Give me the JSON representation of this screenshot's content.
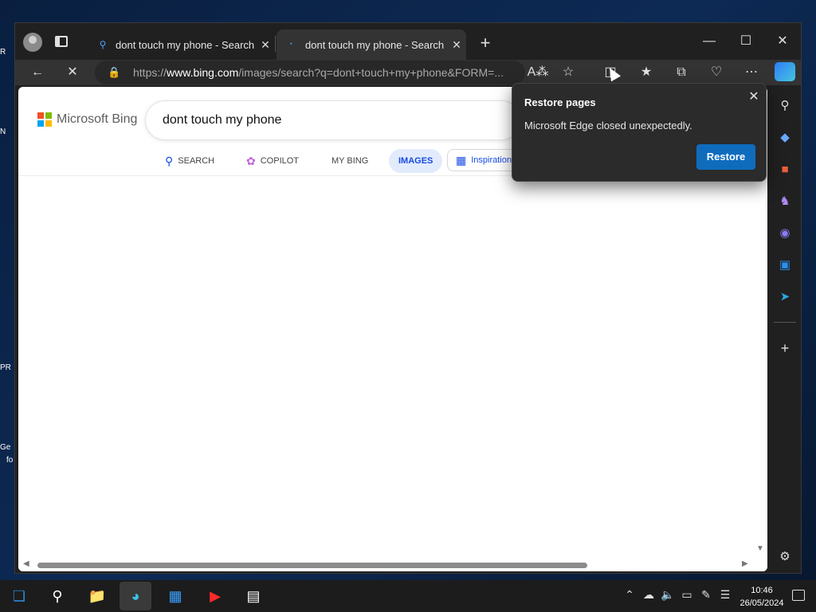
{
  "desktop": {
    "icons": [
      "R",
      "N",
      "PR",
      "Ge",
      "fo"
    ]
  },
  "browser": {
    "tabs": [
      {
        "title": "dont touch my phone - Search",
        "close": "✕"
      },
      {
        "title": "dont touch my phone - Search la",
        "close": "✕"
      }
    ],
    "new_tab": "+",
    "window_controls": {
      "minimize": "—",
      "maximize": "☐",
      "close": "✕"
    },
    "address": {
      "scheme": "https://",
      "host": "www.bing.com",
      "path": "/images/search?q=dont+touch+my+phone&FORM=..."
    }
  },
  "bing": {
    "logo_text": "Microsoft Bing",
    "query": "dont touch my phone",
    "nav": [
      {
        "label": "SEARCH",
        "icon": "search-icon"
      },
      {
        "label": "COPILOT",
        "icon": "copilot-icon"
      },
      {
        "label": "MY BING",
        "icon": ""
      },
      {
        "label": "IMAGES",
        "icon": "",
        "active": true
      },
      {
        "label": "Inspiration",
        "icon": "inspiration-icon"
      }
    ]
  },
  "popup": {
    "title": "Restore pages",
    "message": "Microsoft Edge closed unexpectedly.",
    "button": "Restore",
    "close": "✕"
  },
  "sidebar": {
    "icons": [
      "search-icon",
      "shopping-icon",
      "tools-icon",
      "games-icon",
      "copilot-icon",
      "outlook-icon",
      "telegram-icon",
      "add-icon"
    ]
  },
  "taskbar": {
    "time": "10:46",
    "date": "26/05/2024"
  },
  "colors": {
    "accent": "#0f6cbd",
    "bing_active": "#174ae4"
  }
}
